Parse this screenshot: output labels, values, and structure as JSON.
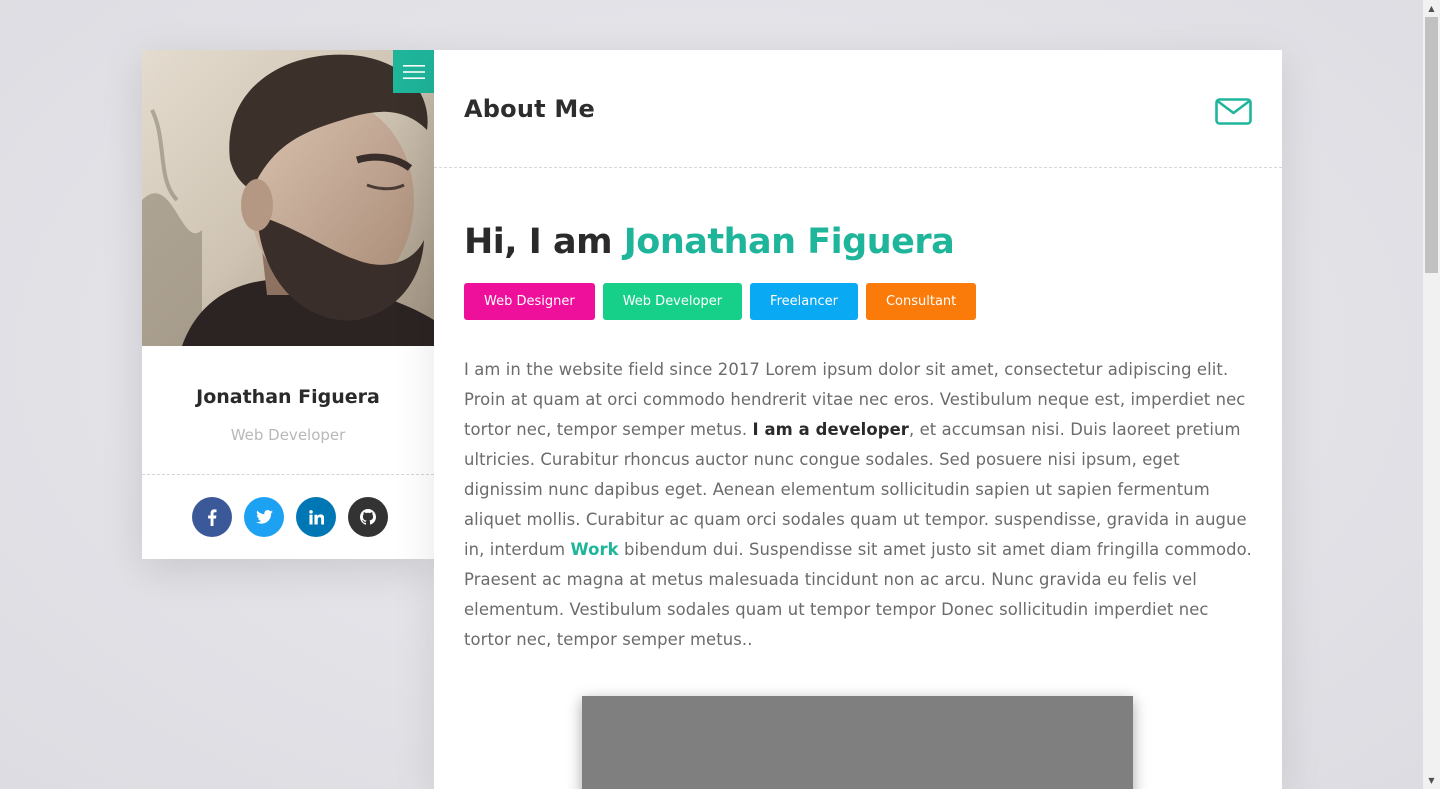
{
  "profile": {
    "name": "Jonathan Figuera",
    "role": "Web Developer",
    "photo_icon": "profile-photo",
    "menu_icon": "hamburger-menu-icon",
    "socials": [
      {
        "icon": "facebook-icon",
        "glyph": "f",
        "color": "#3b5998"
      },
      {
        "icon": "twitter-icon",
        "glyph": "t",
        "color": "#1da1f2"
      },
      {
        "icon": "linkedin-icon",
        "glyph": "in",
        "color": "#0077b5"
      },
      {
        "icon": "github-icon",
        "glyph": "gh",
        "color": "#333333"
      }
    ]
  },
  "header": {
    "title": "About Me",
    "mail_icon": "envelope-icon"
  },
  "hero": {
    "prefix": "Hi, I am ",
    "name": "Jonathan Figuera"
  },
  "tags": [
    {
      "label": "Web Designer",
      "color": "#ee0f9a"
    },
    {
      "label": "Web Developer",
      "color": "#16d08a"
    },
    {
      "label": "Freelancer",
      "color": "#09a9f4"
    },
    {
      "label": "Consultant",
      "color": "#fa7a0a"
    }
  ],
  "bio": {
    "part1": "I am in the website field since 2017 Lorem ipsum dolor sit amet, consectetur adipiscing elit. Proin at quam at orci commodo hendrerit vitae nec eros. Vestibulum neque est, imperdiet nec tortor nec, tempor semper metus. ",
    "strong": "I am a developer",
    "part2": ", et accumsan nisi. Duis laoreet pretium ultricies. Curabitur rhoncus auctor nunc congue sodales. Sed posuere nisi ipsum, eget dignissim nunc dapibus eget. Aenean elementum sollicitudin sapien ut sapien fermentum aliquet mollis. Curabitur ac quam orci sodales quam ut tempor. suspendisse, gravida in augue in, interdum ",
    "link": "Work",
    "part3": " bibendum dui. Suspendisse sit amet justo sit amet diam fringilla commodo. Praesent ac magna at metus malesuada tincidunt non ac arcu. Nunc gravida eu felis vel elementum. Vestibulum sodales quam ut tempor tempor Donec sollicitudin imperdiet nec tortor nec, tempor semper metus.."
  },
  "colors": {
    "accent": "#1fb59b",
    "video_placeholder": "#7f7f7f"
  }
}
